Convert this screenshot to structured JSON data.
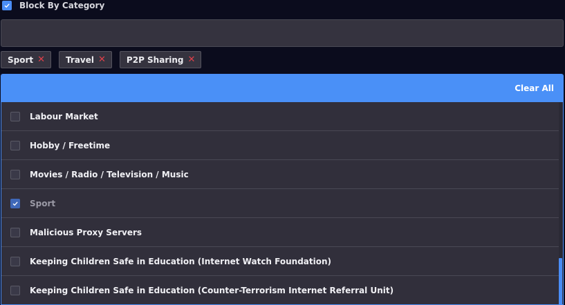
{
  "header": {
    "label": "Block By Category",
    "checked": true
  },
  "search": {
    "value": "",
    "placeholder": ""
  },
  "tags": [
    {
      "label": "Sport",
      "remove_icon": "close-icon"
    },
    {
      "label": "Travel",
      "remove_icon": "close-icon"
    },
    {
      "label": "P2P Sharing",
      "remove_icon": "close-icon"
    }
  ],
  "dropdown": {
    "clear_all_label": "Clear All",
    "items": [
      {
        "label": "Labour Market",
        "checked": false
      },
      {
        "label": "Hobby / Freetime",
        "checked": false
      },
      {
        "label": "Movies / Radio / Television / Music",
        "checked": false
      },
      {
        "label": "Sport",
        "checked": true
      },
      {
        "label": "Malicious Proxy Servers",
        "checked": false
      },
      {
        "label": "Keeping Children Safe in Education (Internet Watch Foundation)",
        "checked": false
      },
      {
        "label": "Keeping Children Safe in Education (Counter-Terrorism Internet Referral Unit)",
        "checked": false
      }
    ]
  },
  "colors": {
    "accent": "#4a8df6",
    "background": "#0b0c1d",
    "panel": "#312f3b",
    "remove": "#e0404a"
  }
}
